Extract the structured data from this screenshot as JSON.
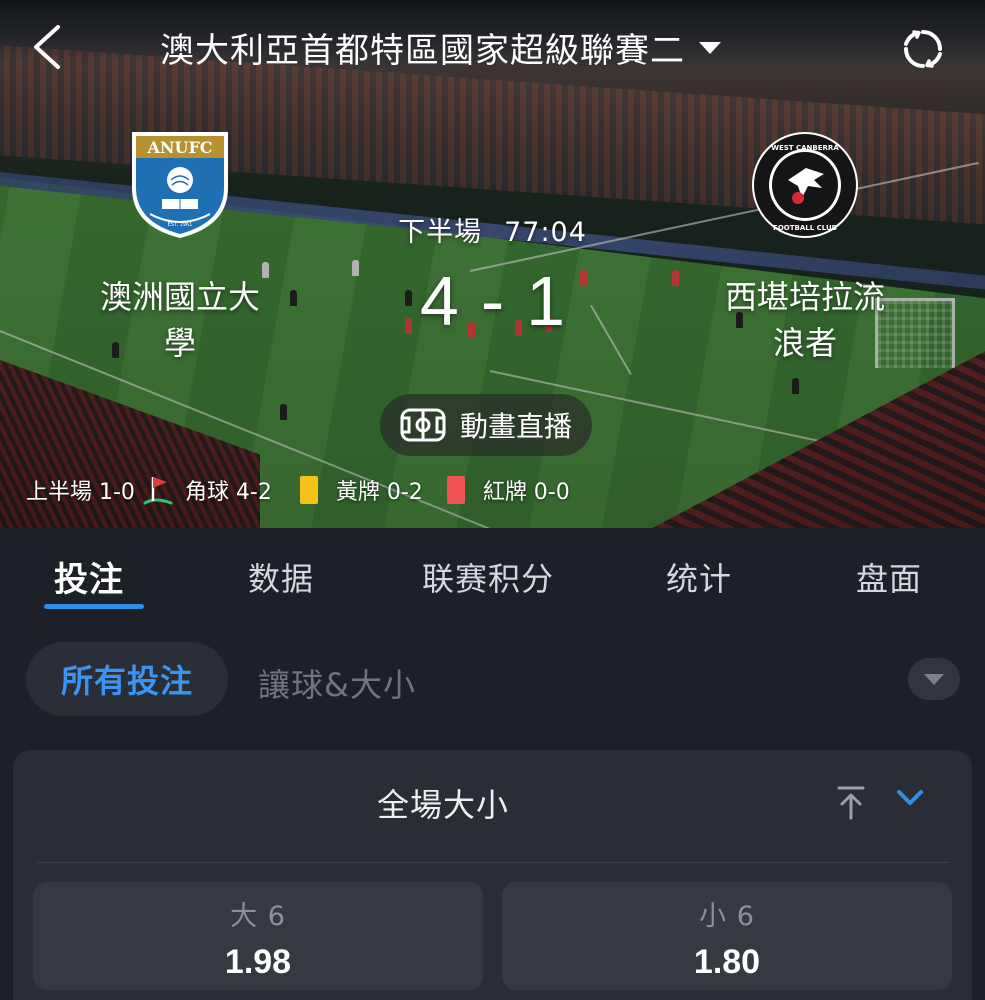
{
  "header": {
    "title": "澳大利亞首都特區國家超級聯賽二"
  },
  "match": {
    "home": {
      "name_line1": "澳洲國立大",
      "name_line2": "學",
      "logo_text": "ANUFC",
      "logo_sub": "EST. 1961"
    },
    "away": {
      "name_line1": "西堪培拉流",
      "name_line2": "浪者",
      "logo_text": "WEST CANBERRA WANDERERS",
      "logo_sub": "FOOTBALL CLUB"
    },
    "period": "下半場",
    "clock": "77:04",
    "score_home": "4",
    "score_sep": "-",
    "score_away": "1",
    "live_button": "動畫直播"
  },
  "stats": {
    "half_time": "上半場 1-0",
    "corners": "角球 4-2",
    "yellow": "黃牌 0-2",
    "red": "紅牌 0-0"
  },
  "tabs": [
    {
      "label": "投注",
      "active": true
    },
    {
      "label": "数据",
      "active": false
    },
    {
      "label": "联赛积分",
      "active": false
    },
    {
      "label": "统计",
      "active": false
    },
    {
      "label": "盘面",
      "active": false
    }
  ],
  "filter": {
    "selected": "所有投注",
    "other": "讓球&大小"
  },
  "market": {
    "title": "全場大小",
    "over": {
      "label": "大 6",
      "odds": "1.98"
    },
    "under": {
      "label": "小 6",
      "odds": "1.80"
    }
  },
  "colors": {
    "accent": "#2f8fe8",
    "background": "#1d2026",
    "card": "#2a2d34",
    "yellow_card": "#f6c21a",
    "red_card": "#f05353"
  }
}
